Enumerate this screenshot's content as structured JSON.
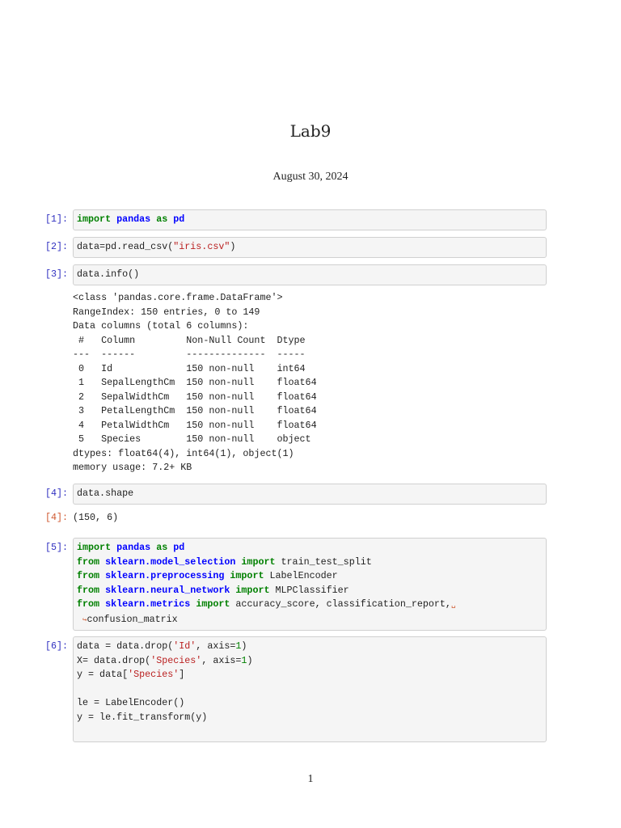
{
  "title": "Lab9",
  "date": "August 30, 2024",
  "page_number": "1",
  "cells": [
    {
      "prompt": "[1]:",
      "lines": [
        [
          [
            "kw",
            "import"
          ],
          [
            "p",
            " "
          ],
          [
            "mod",
            "pandas"
          ],
          [
            "p",
            " "
          ],
          [
            "kw",
            "as"
          ],
          [
            "p",
            " "
          ],
          [
            "mod",
            "pd"
          ]
        ]
      ]
    },
    {
      "prompt": "[2]:",
      "lines": [
        [
          [
            "p",
            "data=pd.read_csv("
          ],
          [
            "str",
            "\"iris.csv\""
          ],
          [
            "p",
            ")"
          ]
        ]
      ]
    },
    {
      "prompt": "[3]:",
      "lines": [
        [
          [
            "p",
            "data.info()"
          ]
        ]
      ]
    },
    {
      "prompt": "[4]:",
      "lines": [
        [
          [
            "p",
            "data.shape"
          ]
        ]
      ]
    },
    {
      "prompt": "[5]:",
      "lines": [
        [
          [
            "kw",
            "import"
          ],
          [
            "p",
            " "
          ],
          [
            "mod",
            "pandas"
          ],
          [
            "p",
            " "
          ],
          [
            "kw",
            "as"
          ],
          [
            "p",
            " "
          ],
          [
            "mod",
            "pd"
          ]
        ],
        [
          [
            "kw",
            "from"
          ],
          [
            "p",
            " "
          ],
          [
            "mod",
            "sklearn.model_selection"
          ],
          [
            "p",
            " "
          ],
          [
            "kw",
            "import"
          ],
          [
            "p",
            " train_test_split"
          ]
        ],
        [
          [
            "kw",
            "from"
          ],
          [
            "p",
            " "
          ],
          [
            "mod",
            "sklearn.preprocessing"
          ],
          [
            "p",
            " "
          ],
          [
            "kw",
            "import"
          ],
          [
            "p",
            " LabelEncoder"
          ]
        ],
        [
          [
            "kw",
            "from"
          ],
          [
            "p",
            " "
          ],
          [
            "mod",
            "sklearn.neural_network"
          ],
          [
            "p",
            " "
          ],
          [
            "kw",
            "import"
          ],
          [
            "p",
            " MLPClassifier"
          ]
        ],
        [
          [
            "kw",
            "from"
          ],
          [
            "p",
            " "
          ],
          [
            "mod",
            "sklearn.metrics"
          ],
          [
            "p",
            " "
          ],
          [
            "kw",
            "import"
          ],
          [
            "p",
            " accuracy_score, classification_report,"
          ],
          [
            "cont",
            "␣"
          ]
        ],
        [
          [
            "p",
            " "
          ],
          [
            "cont",
            "↪"
          ],
          [
            "p",
            "confusion_matrix"
          ]
        ]
      ]
    },
    {
      "prompt": "[6]:",
      "lines": [
        [
          [
            "p",
            "data = data.drop("
          ],
          [
            "str",
            "'Id'"
          ],
          [
            "p",
            ", axis="
          ],
          [
            "num",
            "1"
          ],
          [
            "p",
            ")"
          ]
        ],
        [
          [
            "p",
            "X= data.drop("
          ],
          [
            "str",
            "'Species'"
          ],
          [
            "p",
            ", axis="
          ],
          [
            "num",
            "1"
          ],
          [
            "p",
            ")"
          ]
        ],
        [
          [
            "p",
            "y = data["
          ],
          [
            "str",
            "'Species'"
          ],
          [
            "p",
            "]"
          ]
        ],
        [
          [
            "p",
            " "
          ]
        ],
        [
          [
            "p",
            "le = LabelEncoder()"
          ]
        ],
        [
          [
            "p",
            "y = le.fit_transform(y)"
          ]
        ],
        [
          [
            "p",
            " "
          ]
        ]
      ]
    }
  ],
  "outputs": {
    "info": [
      "<class 'pandas.core.frame.DataFrame'>",
      "RangeIndex: 150 entries, 0 to 149",
      "Data columns (total 6 columns):",
      " #   Column         Non-Null Count  Dtype  ",
      "---  ------         --------------  -----  ",
      " 0   Id             150 non-null    int64  ",
      " 1   SepalLengthCm  150 non-null    float64",
      " 2   SepalWidthCm   150 non-null    float64",
      " 3   PetalLengthCm  150 non-null    float64",
      " 4   PetalWidthCm   150 non-null    float64",
      " 5   Species        150 non-null    object ",
      "dtypes: float64(4), int64(1), object(1)",
      "memory usage: 7.2+ KB"
    ],
    "shape_prompt": "[4]:",
    "shape": "(150, 6)"
  }
}
